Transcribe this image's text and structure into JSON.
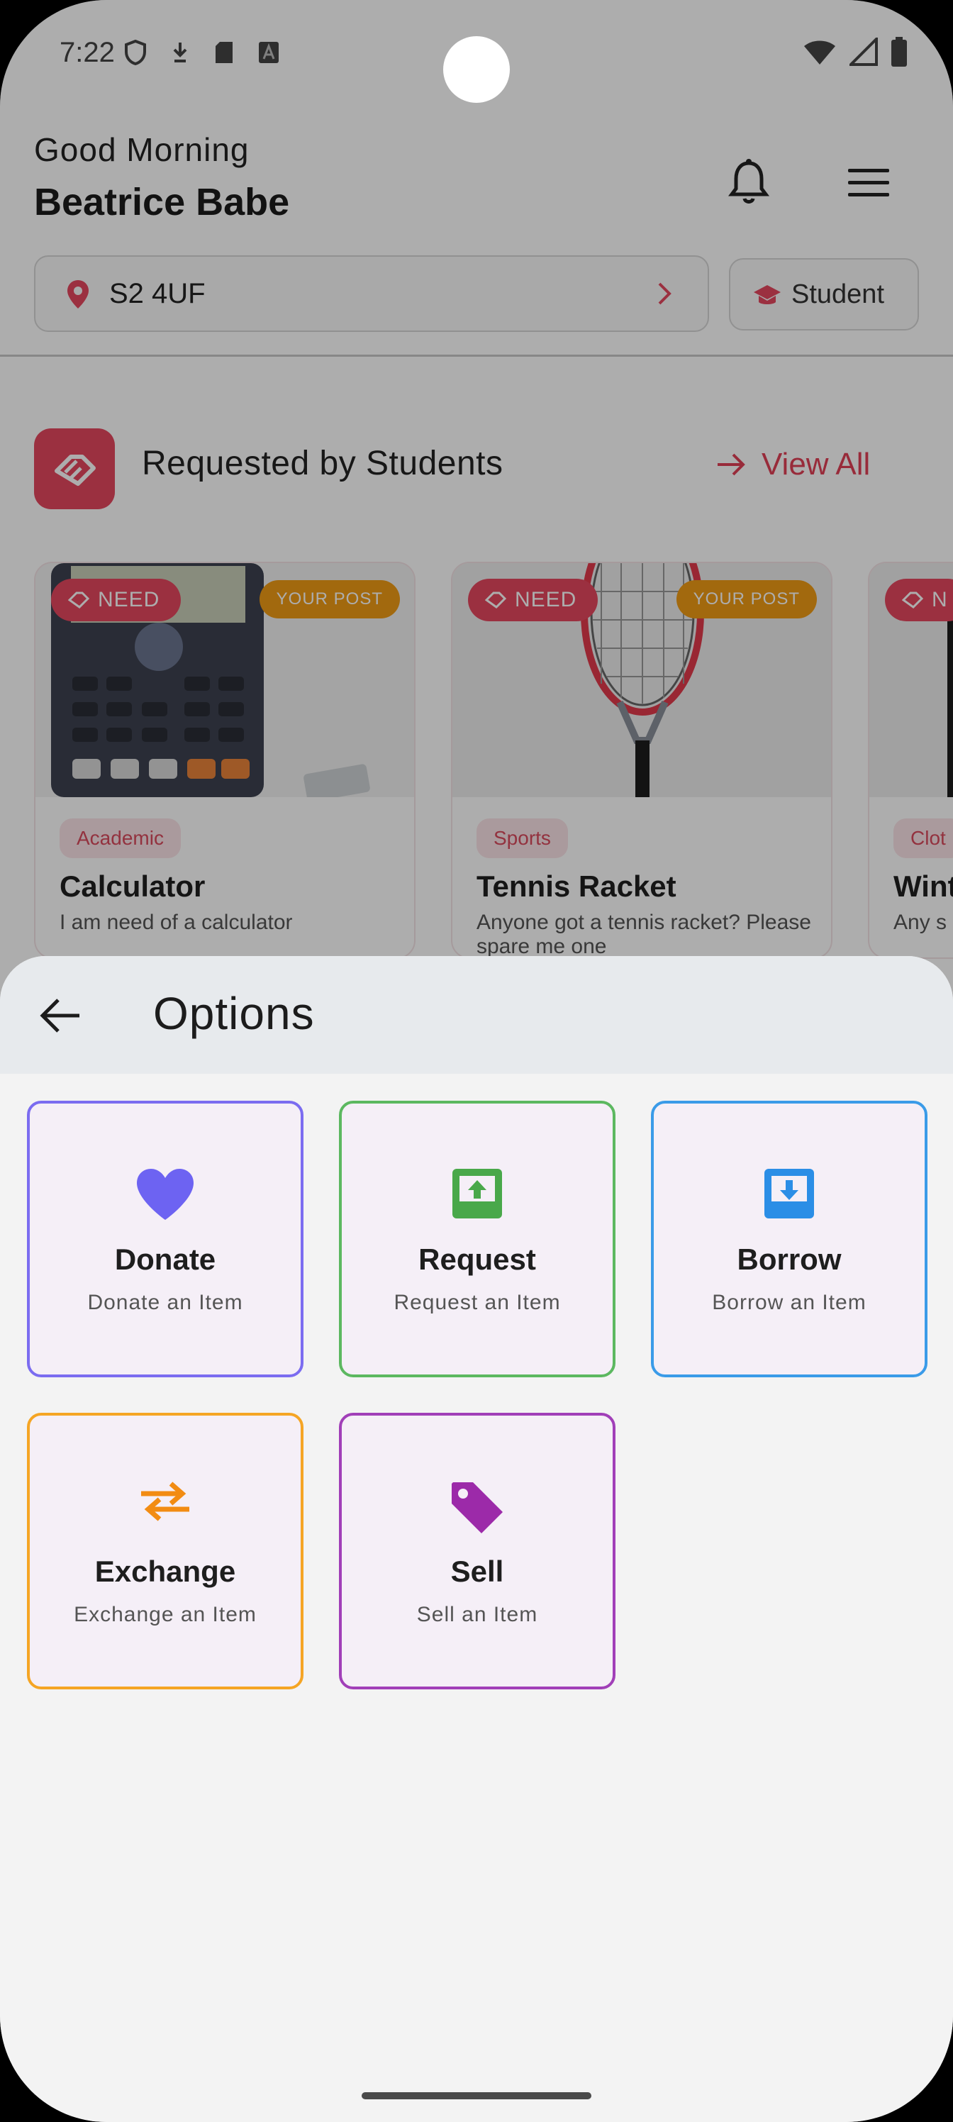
{
  "status_bar": {
    "time": "7:22"
  },
  "header": {
    "greeting": "Good Morning",
    "user_name": "Beatrice Babe",
    "location": "S2 4UF",
    "role": "Student"
  },
  "section": {
    "title": "Requested by Students",
    "view_all": "View All"
  },
  "cards": [
    {
      "badge": "NEED",
      "post_badge": "YOUR POST",
      "category": "Academic",
      "title": "Calculator",
      "description": "I am need of a calculator"
    },
    {
      "badge": "NEED",
      "post_badge": "YOUR POST",
      "category": "Sports",
      "title": "Tennis Racket",
      "description": "Anyone got a tennis racket? Please spare me one"
    },
    {
      "badge": "N",
      "category": "Clot",
      "title": "Wint",
      "description": "Any s pleas"
    }
  ],
  "sheet": {
    "title": "Options",
    "options": [
      {
        "label": "Donate",
        "subtitle": "Donate an Item",
        "color": "#7b6cf0",
        "icon": "heart-icon"
      },
      {
        "label": "Request",
        "subtitle": "Request an Item",
        "color": "#5cb860",
        "icon": "request-upload-icon"
      },
      {
        "label": "Borrow",
        "subtitle": "Borrow an Item",
        "color": "#3a9be8",
        "icon": "borrow-download-icon"
      },
      {
        "label": "Exchange",
        "subtitle": "Exchange an Item",
        "color": "#f5a524",
        "icon": "exchange-arrows-icon"
      },
      {
        "label": "Sell",
        "subtitle": "Sell an Item",
        "color": "#a13fb8",
        "icon": "price-tag-icon"
      }
    ]
  },
  "colors": {
    "accent": "#e5485f",
    "your_post": "#ef9b16"
  }
}
